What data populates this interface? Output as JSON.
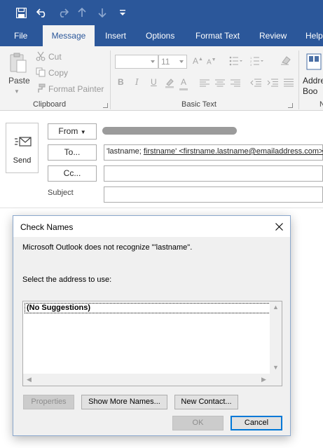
{
  "quick_access": {
    "save_icon": "floppy-disk-icon",
    "undo_icon": "undo-arrow-icon",
    "redo_icon": "redo-arrow-icon",
    "up_icon": "previous-item-arrow-icon",
    "down_icon": "next-item-arrow-icon",
    "customize_icon": "customize-toolbar-icon"
  },
  "ribbon_tabs": [
    {
      "label": "File"
    },
    {
      "label": "Message",
      "active": true
    },
    {
      "label": "Insert"
    },
    {
      "label": "Options"
    },
    {
      "label": "Format Text"
    },
    {
      "label": "Review"
    },
    {
      "label": "Help"
    }
  ],
  "clipboard": {
    "paste": "Paste",
    "cut": "Cut",
    "copy": "Copy",
    "format_painter": "Format Painter",
    "group_label": "Clipboard"
  },
  "basic_text": {
    "font_size": "11",
    "grow_font": "A",
    "shrink_font": "A",
    "bold": "B",
    "italic": "I",
    "underline": "U",
    "font_color": "A",
    "group_label": "Basic Text"
  },
  "names": {
    "address_book": "Addre\nBoo",
    "group_label_fragment": "N"
  },
  "message": {
    "send": "Send",
    "from": "From",
    "to_button": "To...",
    "cc_button": "Cc...",
    "subject_label": "Subject",
    "to_value_part1": "'lastname; ",
    "to_value_part2": "firstname' <firstname.lastname@emailaddress.com>"
  },
  "dialog": {
    "title": "Check Names",
    "message": "Microsoft Outlook does not recognize \"'lastname\".",
    "select_prompt": "Select the address to use:",
    "suggestions": [
      "(No Suggestions)"
    ],
    "buttons": {
      "properties": "Properties",
      "show_more_names": "Show More Names...",
      "new_contact": "New Contact...",
      "ok": "OK",
      "cancel": "Cancel"
    }
  },
  "colors": {
    "brand": "#2b579a",
    "ribbon_bg": "#f3f3f3",
    "dialog_bg": "#f0f0f0",
    "focus_blue": "#0078d7"
  }
}
